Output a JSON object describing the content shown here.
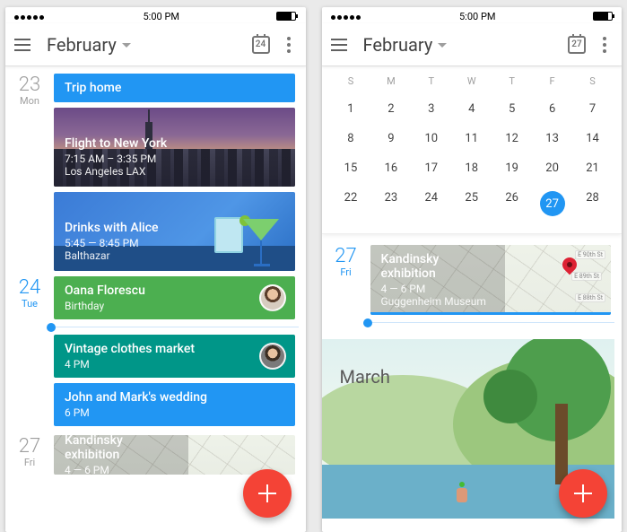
{
  "status": {
    "time": "5:00 PM"
  },
  "left": {
    "header": {
      "month": "February",
      "today_badge": "24"
    },
    "days": [
      {
        "num": "23",
        "dow": "Mon",
        "accent": false,
        "events": [
          {
            "kind": "bar",
            "color": "blue",
            "title": "Trip home"
          },
          {
            "kind": "photo_skyline",
            "title": "Flight to New York",
            "sub": "7:15 AM – 3:35 PM",
            "loc": "Los Angeles LAX"
          },
          {
            "kind": "photo_drinks",
            "title": "Drinks with Alice",
            "sub": "5:45 — 8:45 PM",
            "loc": "Balthazar"
          }
        ]
      },
      {
        "num": "24",
        "dow": "Tue",
        "accent": true,
        "events": [
          {
            "kind": "avatar",
            "color": "green",
            "avatar": "a1",
            "title": "Oana Florescu",
            "sub": "Birthday"
          }
        ],
        "nowAfter": true,
        "events2": [
          {
            "kind": "avatar",
            "color": "teal",
            "avatar": "a2",
            "title": "Vintage clothes market",
            "sub": "4 PM"
          },
          {
            "kind": "bar",
            "color": "blue",
            "title": "John and Mark's wedding",
            "sub": "6 PM"
          }
        ]
      },
      {
        "num": "27",
        "dow": "Fri",
        "accent": false,
        "events": [
          {
            "kind": "map_peek",
            "title": "Kandinsky exhibition",
            "sub": "4 — 6 PM"
          }
        ]
      }
    ]
  },
  "right": {
    "header": {
      "month": "February",
      "today_badge": "27"
    },
    "dows": [
      "S",
      "M",
      "T",
      "W",
      "T",
      "F",
      "S"
    ],
    "grid": [
      [
        1,
        2,
        3,
        4,
        5,
        6,
        7
      ],
      [
        8,
        9,
        10,
        11,
        12,
        13,
        14
      ],
      [
        15,
        16,
        17,
        18,
        19,
        20,
        21
      ],
      [
        22,
        23,
        24,
        25,
        26,
        27,
        28
      ]
    ],
    "selected": 27,
    "day": {
      "num": "27",
      "dow": "Fri",
      "event": {
        "title": "Kandinsky exhibition",
        "sub": "4 — 6 PM",
        "loc": "Guggenheim Museum"
      },
      "map_labels": [
        "E 90th St",
        "E 89th St",
        "E 88th St"
      ]
    },
    "next_month": "March"
  }
}
